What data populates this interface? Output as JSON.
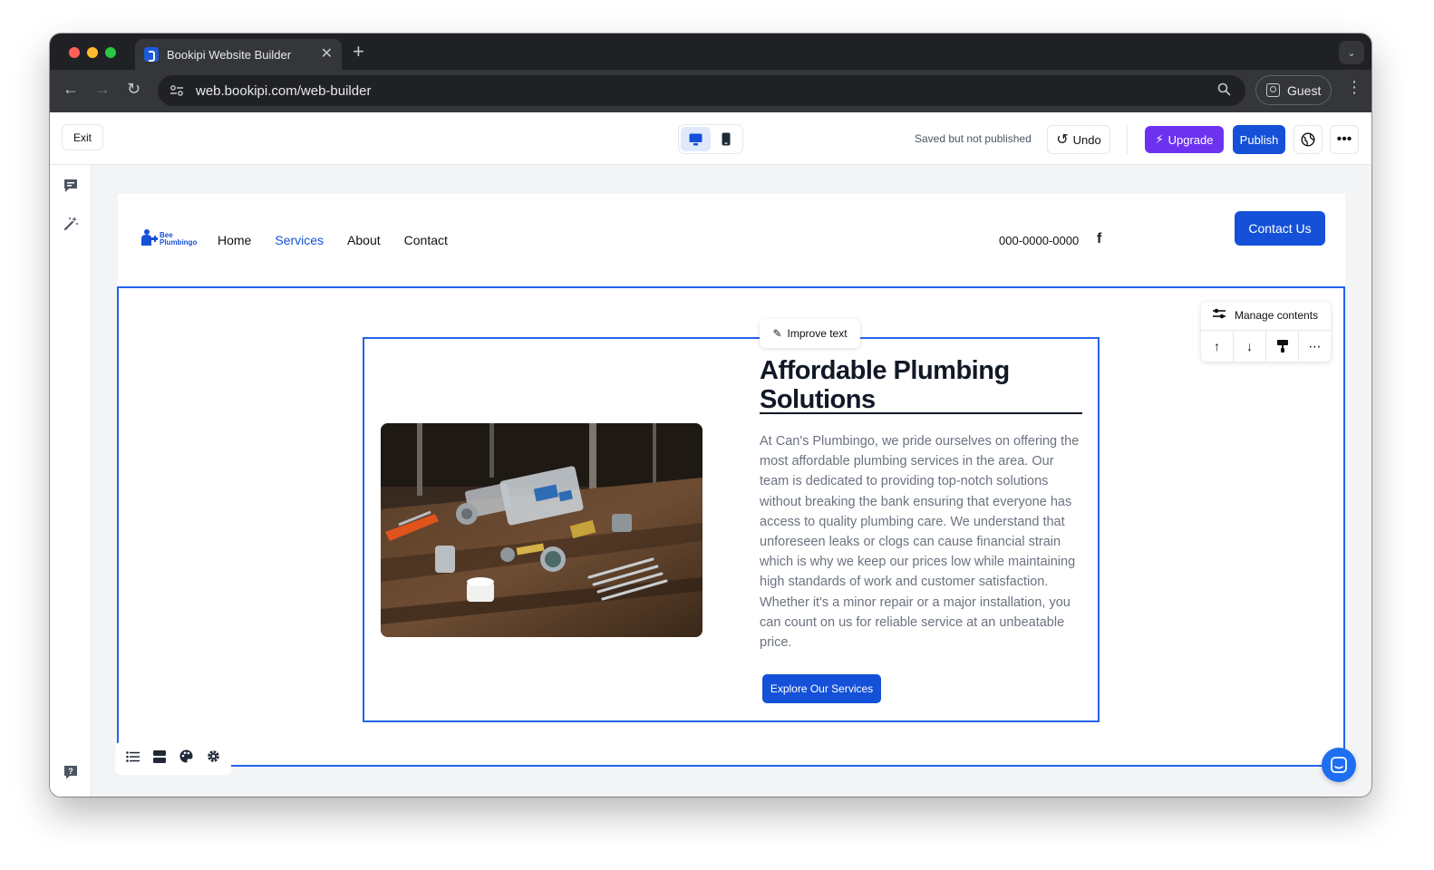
{
  "browser": {
    "tab_title": "Bookipi Website Builder",
    "url": "web.bookipi.com/web-builder",
    "profile_label": "Guest"
  },
  "builder": {
    "exit_label": "Exit",
    "save_status": "Saved but not published",
    "undo_label": "Undo",
    "upgrade_label": "Upgrade",
    "publish_label": "Publish",
    "active_device": "desktop"
  },
  "site": {
    "logo_line1": "Bee",
    "logo_line2": "Plumbingo",
    "nav": [
      "Home",
      "Services",
      "About",
      "Contact"
    ],
    "active_nav": "Services",
    "phone": "000-0000-0000",
    "contact_button": "Contact Us"
  },
  "section": {
    "improve_text_label": "Improve text",
    "heading": "Affordable Plumbing Solutions",
    "paragraph": "At Can's Plumbingo, we pride ourselves on offering the most affordable plumbing services in the area. Our team is dedicated to providing top-notch solutions without breaking the bank ensuring that everyone has access to quality plumbing care. We understand that unforeseen leaks or clogs can cause financial strain which is why we keep our prices low while maintaining high standards of work and customer satisfaction. Whether it's a minor repair or a major installation, you can count on us for reliable service at an unbeatable price.",
    "cta_label": "Explore Our Services",
    "manage_contents_label": "Manage contents"
  },
  "colors": {
    "brand_blue": "#1451d8",
    "selection_blue": "#2563eb",
    "upgrade_purple": "#6d32f0"
  }
}
